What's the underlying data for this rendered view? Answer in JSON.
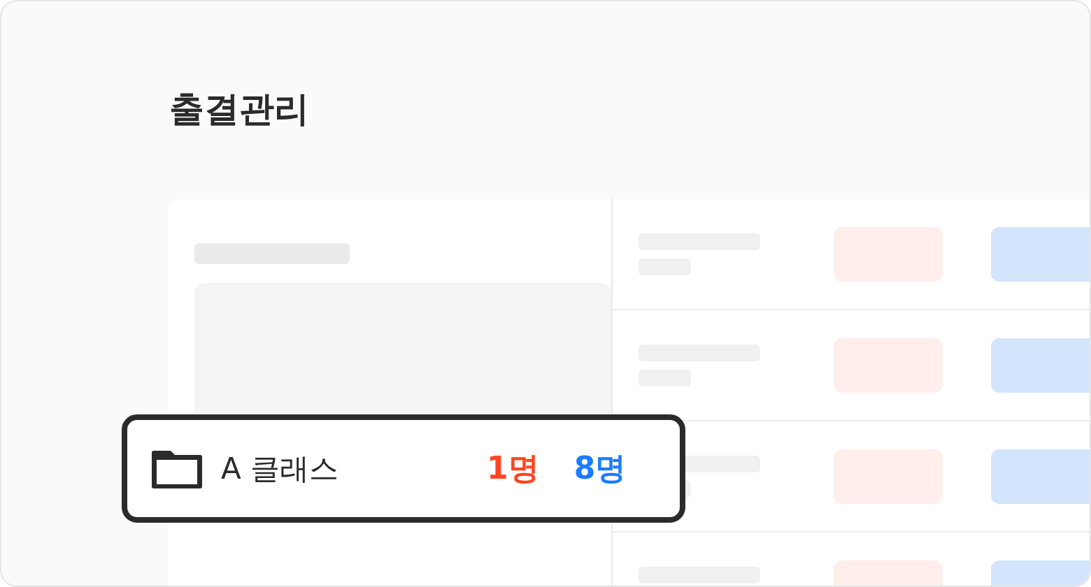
{
  "title": "출결관리",
  "class_card": {
    "name": "A 클래스",
    "counts": [
      {
        "text": "1명",
        "color": "#ff4423"
      },
      {
        "text": "8명",
        "color": "#1b7cff"
      }
    ]
  }
}
